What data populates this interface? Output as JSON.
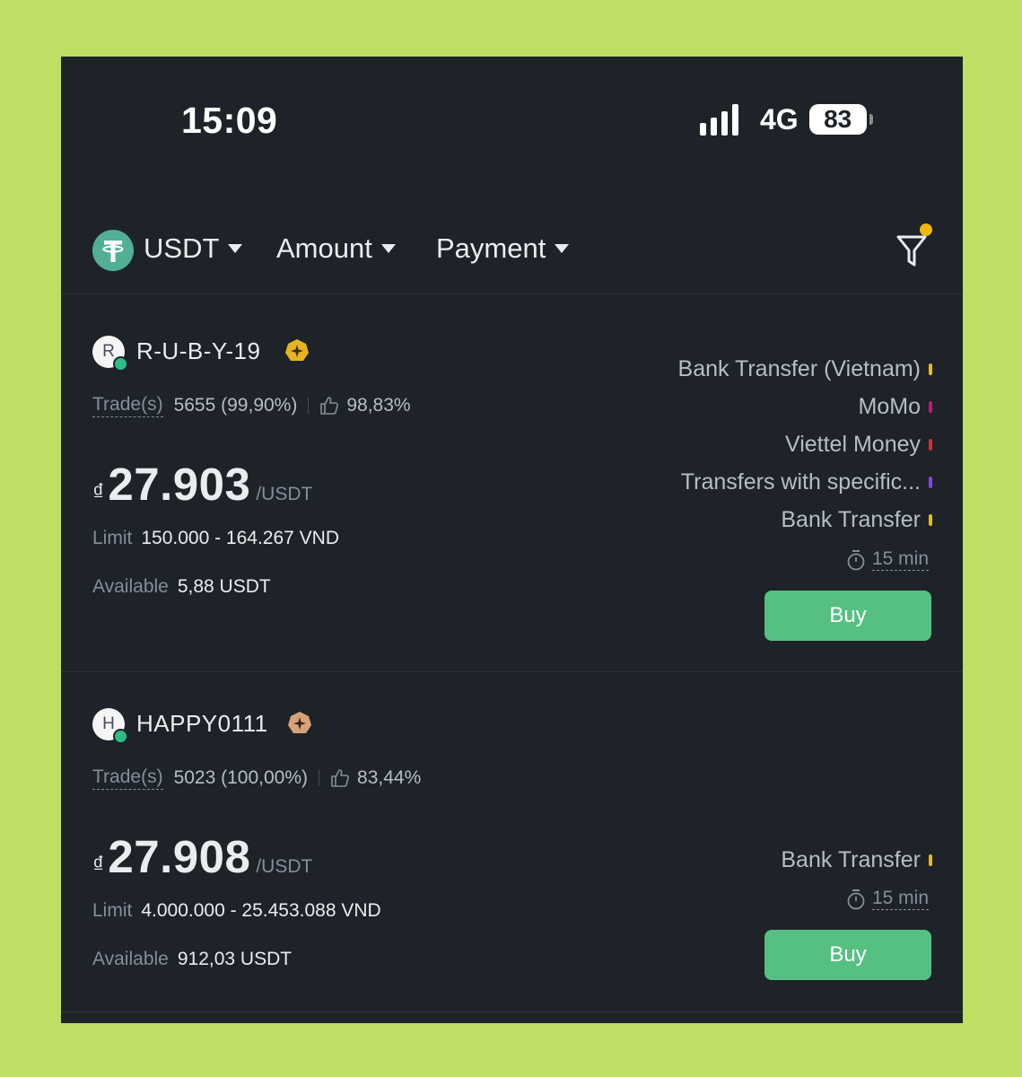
{
  "status_bar": {
    "time": "15:09",
    "network": "4G",
    "battery": "83"
  },
  "filters": {
    "coin": "USDT",
    "amount": "Amount",
    "payment": "Payment"
  },
  "ads": [
    {
      "avatar_letter": "R",
      "merchant": "R-U-B-Y-19",
      "trades_label": "Trade(s)",
      "trades": "5655 (99,90%)",
      "positive_rate": "98,83%",
      "currency_sign": "₫",
      "price": "27.903",
      "price_unit": "/USDT",
      "limit_label": "Limit",
      "limit": "150.000 - 164.267 VND",
      "available_label": "Available",
      "available": "5,88 USDT",
      "payment_methods": [
        {
          "name": "Bank Transfer (Vietnam)",
          "color": "#f0b90b"
        },
        {
          "name": "MoMo",
          "color": "#d10f7d"
        },
        {
          "name": "Viettel Money",
          "color": "#e0262d"
        },
        {
          "name": "Transfers with specific...",
          "color": "#8a3ff2"
        },
        {
          "name": "Bank Transfer",
          "color": "#f0b90b"
        }
      ],
      "time_limit": "15 min",
      "buy_label": "Buy"
    },
    {
      "avatar_letter": "H",
      "merchant": "HAPPY0111",
      "trades_label": "Trade(s)",
      "trades": "5023 (100,00%)",
      "positive_rate": "83,44%",
      "currency_sign": "₫",
      "price": "27.908",
      "price_unit": "/USDT",
      "limit_label": "Limit",
      "limit": "4.000.000 - 25.453.088 VND",
      "available_label": "Available",
      "available": "912,03 USDT",
      "payment_methods": [
        {
          "name": "Bank Transfer",
          "color": "#f0b90b"
        }
      ],
      "time_limit": "15 min",
      "buy_label": "Buy"
    }
  ]
}
